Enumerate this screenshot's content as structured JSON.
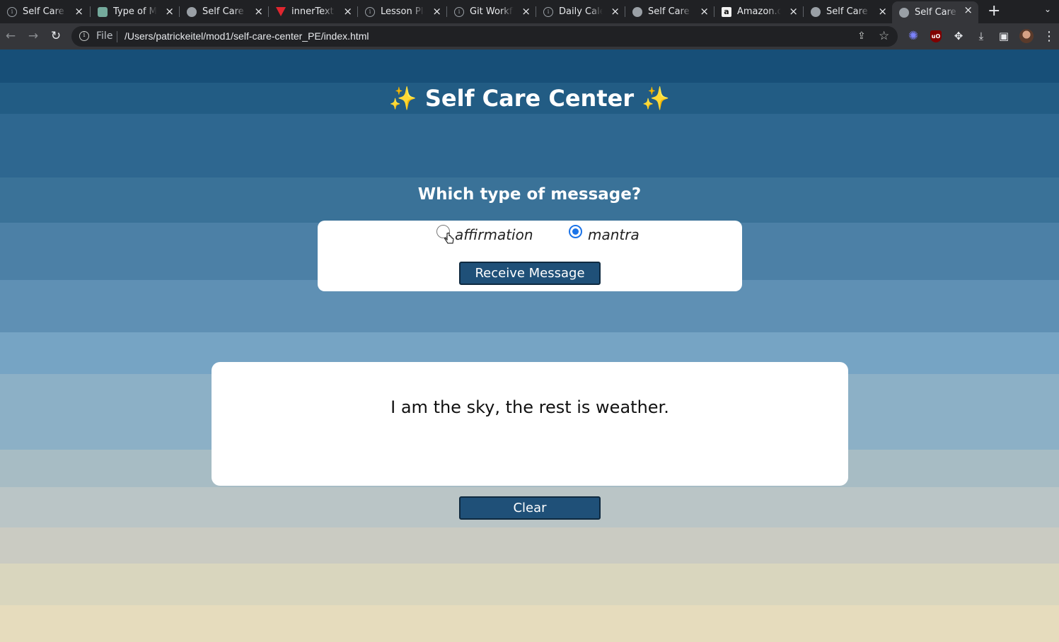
{
  "browser": {
    "tabs": [
      {
        "title": "Self Care C",
        "icon": "info-icon"
      },
      {
        "title": "Type of Me",
        "icon": "chatgpt-icon"
      },
      {
        "title": "Self Care C",
        "icon": "globe-icon"
      },
      {
        "title": "innerText v",
        "icon": "turing-icon"
      },
      {
        "title": "Lesson Pla",
        "icon": "info-icon"
      },
      {
        "title": "Git Workflo",
        "icon": "info-icon"
      },
      {
        "title": "Daily Calen",
        "icon": "info-icon"
      },
      {
        "title": "Self Care C",
        "icon": "globe-icon"
      },
      {
        "title": "Amazon.co",
        "icon": "amazon-icon"
      },
      {
        "title": "Self Care C",
        "icon": "globe-icon"
      },
      {
        "title": "Self Care C",
        "icon": "globe-icon",
        "active": true
      }
    ],
    "new_tab_glyph": "+",
    "address": {
      "scheme_label": "File",
      "url": "/Users/patrickeitel/mod1/self-care-center_PE/index.html"
    },
    "extensions": [
      "grammarly-icon",
      "ublock-icon",
      "extensions-puzzle-icon",
      "downloads-icon",
      "side-panel-icon",
      "profile-avatar",
      "menu-kebab-icon"
    ]
  },
  "page": {
    "title": "Self Care Center",
    "title_sparkle": "✨",
    "question": "Which type of message?",
    "options": [
      {
        "label": "affirmation",
        "checked": false
      },
      {
        "label": "mantra",
        "checked": true
      }
    ],
    "receive_button": "Receive Message",
    "message": "I am the sky, the rest is weather.",
    "clear_button": "Clear",
    "colors": {
      "button_bg": "#1f5078",
      "gradient_top": "#174f78",
      "gradient_bottom": "#e8dcbc"
    }
  }
}
